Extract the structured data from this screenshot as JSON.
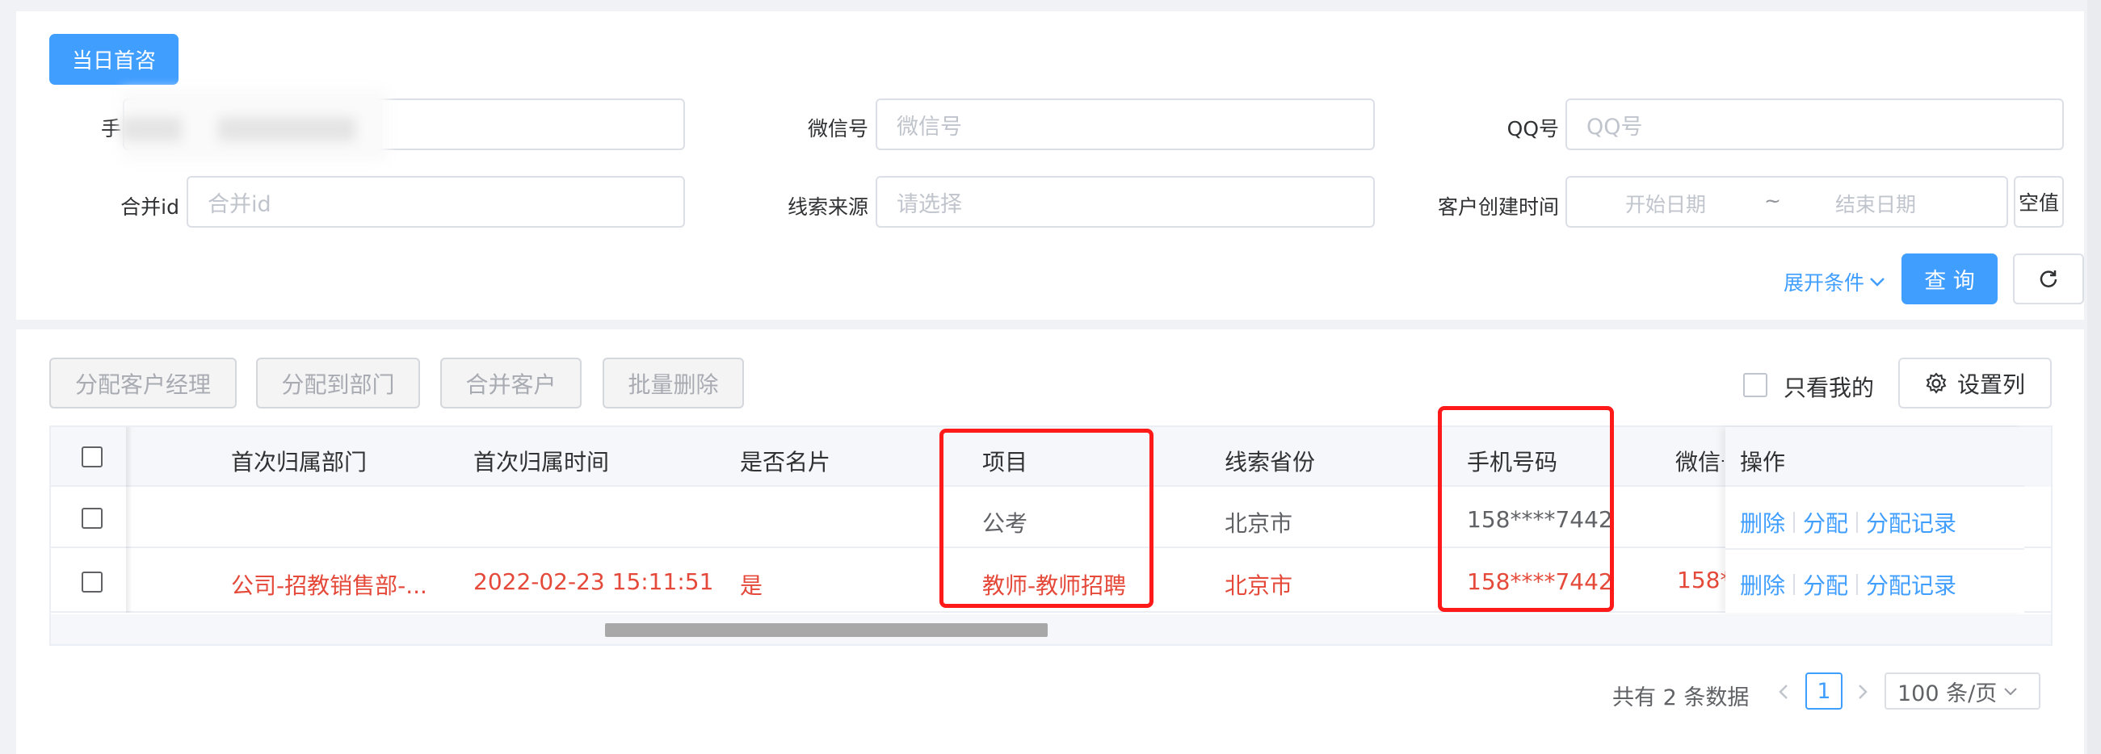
{
  "top_button": "当日首咨",
  "filters": {
    "phone_label": "手",
    "wechat_label": "微信号",
    "wechat_placeholder": "微信号",
    "qq_label": "QQ号",
    "qq_placeholder": "QQ号",
    "merge_label": "合并id",
    "merge_placeholder": "合并id",
    "source_label": "线索来源",
    "source_placeholder": "请选择",
    "created_label": "客户创建时间",
    "start_placeholder": "开始日期",
    "range_sep": "~",
    "end_placeholder": "结束日期",
    "empty_label": "空值",
    "expand_label": "展开条件",
    "query_label": "查 询"
  },
  "toolbar": {
    "assign_manager": "分配客户经理",
    "assign_dept": "分配到部门",
    "merge_customer": "合并客户",
    "batch_delete": "批量删除",
    "only_mine": "只看我的",
    "set_columns": "设置列"
  },
  "table": {
    "headers": {
      "dept": "首次归属部门",
      "time": "首次归属时间",
      "card": "是否名片",
      "project": "项目",
      "province": "线索省份",
      "phone": "手机号码",
      "wechat": "微信号",
      "actions": "操作"
    },
    "rows": [
      {
        "dept": "",
        "time": "",
        "card": "",
        "project": "公考",
        "province": "北京市",
        "phone": "158****7442",
        "wechat": ""
      },
      {
        "dept": "公司-招教销售部-...",
        "time": "2022-02-23 15:11:51",
        "card": "是",
        "project": "教师-教师招聘",
        "province": "北京市",
        "phone": "158****7442",
        "wechat": "158*"
      }
    ],
    "actions": {
      "delete": "删除",
      "assign": "分配",
      "history": "分配记录"
    }
  },
  "pagination": {
    "total": "共有 2 条数据",
    "current": "1",
    "page_size": "100 条/页"
  },
  "colors": {
    "primary": "#409eff",
    "highlight": "#ff1a1a",
    "alert_text": "#e4493a"
  }
}
